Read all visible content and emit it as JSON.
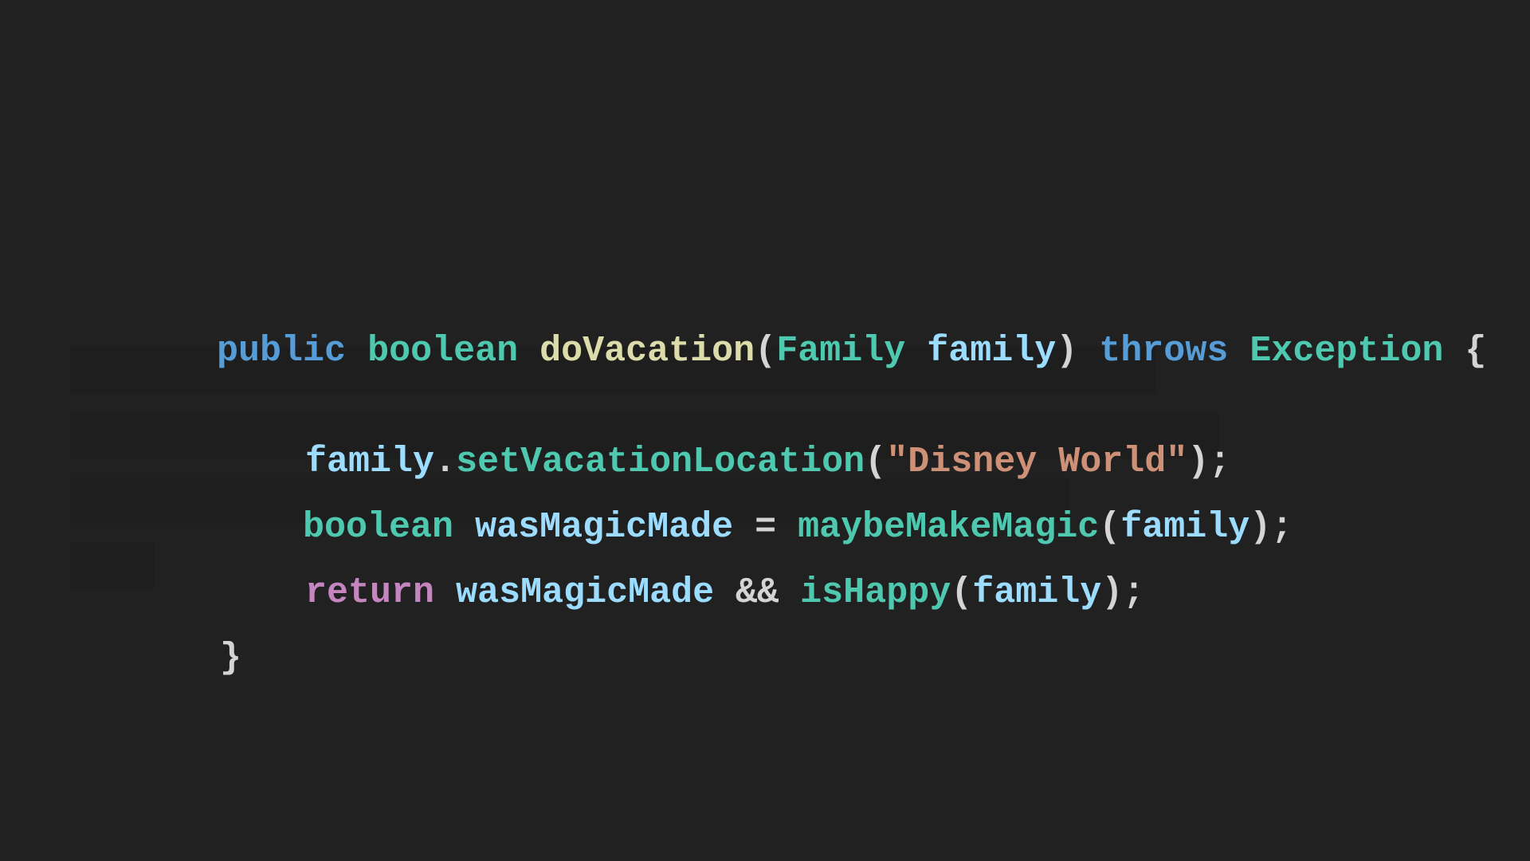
{
  "code": {
    "lines": [
      [
        {
          "text": "public",
          "kind": "keyword"
        },
        {
          "text": " ",
          "kind": "space"
        },
        {
          "text": "boolean",
          "kind": "type"
        },
        {
          "text": " ",
          "kind": "space"
        },
        {
          "text": "doVacation",
          "kind": "function"
        },
        {
          "text": "(",
          "kind": "punctuation"
        },
        {
          "text": "Family",
          "kind": "type"
        },
        {
          "text": " ",
          "kind": "space"
        },
        {
          "text": "family",
          "kind": "variable"
        },
        {
          "text": ")",
          "kind": "punctuation"
        },
        {
          "text": " ",
          "kind": "space"
        },
        {
          "text": "throws",
          "kind": "keyword"
        },
        {
          "text": " ",
          "kind": "space"
        },
        {
          "text": "Exception",
          "kind": "type"
        },
        {
          "text": " ",
          "kind": "space"
        },
        {
          "text": "{",
          "kind": "punctuation"
        }
      ],
      [
        {
          "text": "family",
          "kind": "variable"
        },
        {
          "text": ".",
          "kind": "punctuation"
        },
        {
          "text": "setVacationLocation",
          "kind": "type"
        },
        {
          "text": "(",
          "kind": "punctuation"
        },
        {
          "text": "\"Disney World\"",
          "kind": "string"
        },
        {
          "text": ");",
          "kind": "punctuation"
        }
      ],
      [
        {
          "text": "boolean",
          "kind": "type"
        },
        {
          "text": " ",
          "kind": "space"
        },
        {
          "text": "wasMagicMade",
          "kind": "variable"
        },
        {
          "text": " = ",
          "kind": "punctuation"
        },
        {
          "text": "maybeMakeMagic",
          "kind": "type"
        },
        {
          "text": "(",
          "kind": "punctuation"
        },
        {
          "text": "family",
          "kind": "variable"
        },
        {
          "text": ");",
          "kind": "punctuation"
        }
      ],
      [
        {
          "text": "return",
          "kind": "control"
        },
        {
          "text": " ",
          "kind": "space"
        },
        {
          "text": "wasMagicMade",
          "kind": "variable"
        },
        {
          "text": " && ",
          "kind": "punctuation"
        },
        {
          "text": "isHappy",
          "kind": "type"
        },
        {
          "text": "(",
          "kind": "punctuation"
        },
        {
          "text": "family",
          "kind": "variable"
        },
        {
          "text": ");",
          "kind": "punctuation"
        }
      ],
      [
        {
          "text": "}",
          "kind": "punctuation"
        }
      ]
    ]
  },
  "colors": {
    "background": "#212121",
    "line_highlight": "#1e1e1e",
    "keyword": "#569cd6",
    "type": "#4ec9b0",
    "function": "#dcdcaa",
    "variable": "#9cdcfe",
    "string": "#ce9178",
    "control": "#c586c0",
    "punctuation": "#d4d4d4"
  }
}
